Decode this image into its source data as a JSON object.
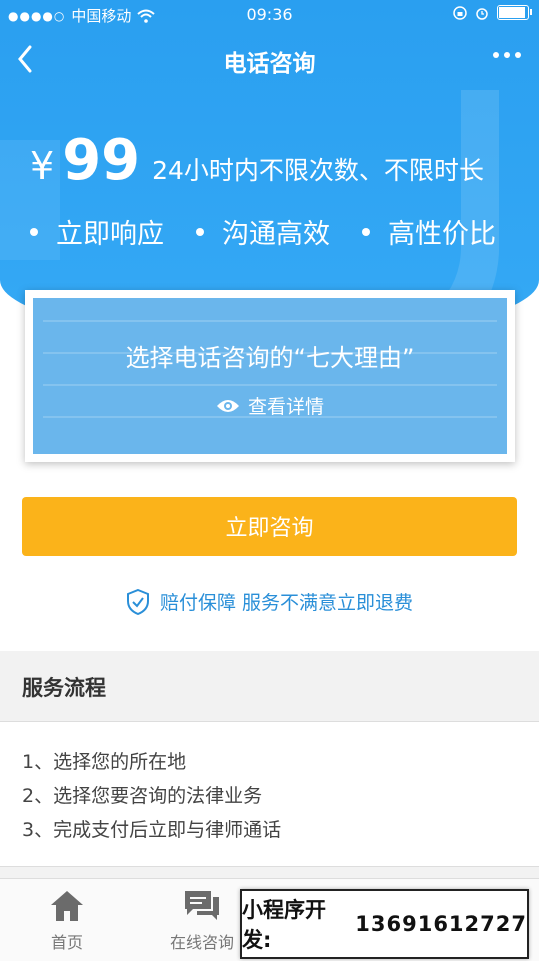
{
  "status_bar": {
    "carrier": "中国移动",
    "time": "09:36"
  },
  "nav": {
    "title": "电话咨询"
  },
  "hero": {
    "currency": "¥",
    "price": "99",
    "description": "24小时内不限次数、不限时长",
    "features": [
      "立即响应",
      "沟通高效",
      "高性价比"
    ]
  },
  "reason_card": {
    "title": "选择电话咨询的“七大理由”",
    "link_label": "查看详情"
  },
  "cta": {
    "label": "立即咨询"
  },
  "guarantee": {
    "text": "赔付保障 服务不满意立即退费"
  },
  "process": {
    "title": "服务流程",
    "steps": [
      "1、选择您的所在地",
      "2、选择您要咨询的法律业务",
      "3、完成支付后立即与律师通话"
    ]
  },
  "tabbar": {
    "tabs": [
      "首页",
      "在线咨询"
    ]
  },
  "promo": {
    "label": "小程序开发:",
    "phone": "13691612727"
  },
  "colors": {
    "primary": "#2a9ff0",
    "cta": "#fbb31a",
    "accent_text": "#2a8fd8"
  }
}
